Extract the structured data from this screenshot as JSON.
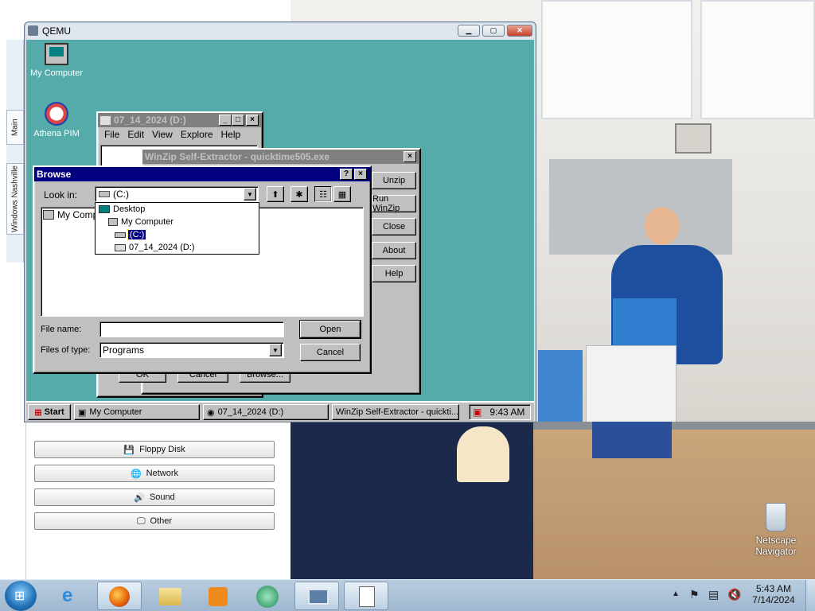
{
  "host_panel": {
    "vertical_tabs": [
      "Main",
      "Windows Nashville"
    ],
    "buttons": [
      {
        "label": "Floppy Disk",
        "icon": "floppy-icon"
      },
      {
        "label": "Network",
        "icon": "network-icon"
      },
      {
        "label": "Sound",
        "icon": "sound-icon"
      },
      {
        "label": "Other",
        "icon": "monitor-icon"
      }
    ]
  },
  "host_desktop": {
    "recycle_bin_label": "Netscape Navigator"
  },
  "qemu": {
    "title": "QEMU",
    "desktop_icons": [
      {
        "label": "My Computer",
        "icon": "computer-icon"
      },
      {
        "label": "Athena PIM",
        "icon": "athena-pim-icon"
      }
    ],
    "explorer": {
      "title": "07_14_2024 (D:)",
      "menu": [
        "File",
        "Edit",
        "View",
        "Explore",
        "Help"
      ]
    },
    "winzip": {
      "title": "WinZip Self-Extractor - quicktime505.exe",
      "buttons": [
        "Unzip",
        "Run WinZip",
        "Close",
        "About",
        "Help"
      ],
      "bottom_buttons": [
        "OK",
        "Cancel",
        "Browse..."
      ]
    },
    "browse": {
      "title": "Browse",
      "look_in_label": "Look in:",
      "look_in_value": "(C:)",
      "tree": [
        {
          "label": "Desktop",
          "level": 0
        },
        {
          "label": "My Computer",
          "level": 1
        },
        {
          "label": "(C:)",
          "level": 2,
          "selected": true
        },
        {
          "label": "07_14_2024 (D:)",
          "level": 2
        }
      ],
      "list_item": "My Computer",
      "file_name_label": "File name:",
      "file_name_value": "",
      "files_of_type_label": "Files of type:",
      "files_of_type_value": "Programs",
      "open_label": "Open",
      "cancel_label": "Cancel"
    },
    "taskbar": {
      "start": "Start",
      "tasks": [
        "My Computer",
        "07_14_2024 (D:)",
        "WinZip Self-Extractor - quickti..."
      ],
      "clock": "9:43 AM"
    }
  },
  "host_taskbar": {
    "time": "5:43 AM",
    "date": "7/14/2024"
  },
  "colors": {
    "win95_desktop": "#55aaaa",
    "win95_title_active": "#000080",
    "win95_title_inactive": "#808080"
  }
}
